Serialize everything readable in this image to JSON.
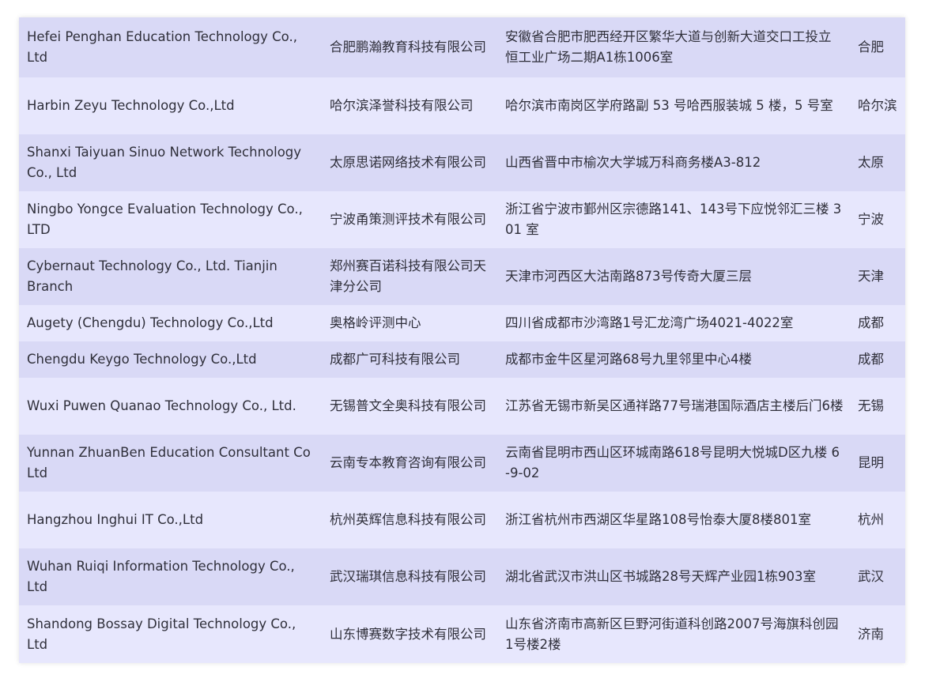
{
  "rows": [
    {
      "en": "Hefei Penghan Education Technology Co., Ltd",
      "cn": "合肥鹏瀚教育科技有限公司",
      "address": "安徽省合肥市肥西经开区繁华大道与创新大道交口工投立恒工业广场二期A1栋1006室",
      "city": "合肥"
    },
    {
      "en": "Harbin Zeyu Technology Co.,Ltd",
      "cn": "哈尔滨泽誉科技有限公司",
      "address": "哈尔滨市南岗区学府路副 53 号哈西服装城 5 楼，5 号室",
      "city": "哈尔滨"
    },
    {
      "en": "Shanxi Taiyuan Sinuo Network Technology Co., Ltd",
      "cn": "太原思诺网络技术有限公司",
      "address": "山西省晋中市榆次大学城万科商务楼A3-812",
      "city": "太原"
    },
    {
      "en": "Ningbo Yongce Evaluation Technology Co., LTD",
      "cn": "宁波甬策测评技术有限公司",
      "address": "浙江省宁波市鄞州区宗德路141、143号下应悦邻汇三楼 301 室",
      "city": "宁波"
    },
    {
      "en": "Cybernaut Technology Co., Ltd. Tianjin Branch",
      "cn": "郑州赛百诺科技有限公司天津分公司",
      "address": "天津市河西区大沽南路873号传奇大厦三层",
      "city": "天津"
    },
    {
      "en": "Augety (Chengdu) Technology Co.,Ltd",
      "cn": "奥格岭评测中心",
      "address": "四川省成都市沙湾路1号汇龙湾广场4021-4022室",
      "city": "成都"
    },
    {
      "en": "Chengdu Keygo Technology Co.,Ltd",
      "cn": "成都广可科技有限公司",
      "address": "成都市金牛区星河路68号九里邻里中心4楼",
      "city": "成都"
    },
    {
      "en": "Wuxi Puwen Quanao Technology Co., Ltd.",
      "cn": "无锡普文全奥科技有限公司",
      "address": "江苏省无锡市新吴区通祥路77号瑞港国际酒店主楼后门6楼",
      "city": "无锡"
    },
    {
      "en": "Yunnan ZhuanBen Education Consultant Co Ltd",
      "cn": "云南专本教育咨询有限公司",
      "address": "云南省昆明市西山区环城南路618号昆明大悦城D区九楼 6-9-02",
      "city": "昆明"
    },
    {
      "en": "Hangzhou Inghui IT Co.,Ltd",
      "cn": "杭州英辉信息科技有限公司",
      "address": "浙江省杭州市西湖区华星路108号怡泰大厦8楼801室",
      "city": "杭州"
    },
    {
      "en": "Wuhan Ruiqi Information Technology Co., Ltd",
      "cn": "武汉瑞琪信息科技有限公司",
      "address": "湖北省武汉市洪山区书城路28号天辉产业园1栋903室",
      "city": "武汉"
    },
    {
      "en": "Shandong Bossay Digital Technology Co., Ltd",
      "cn": "山东博赛数字技术有限公司",
      "address": "山东省济南市高新区巨野河街道科创路2007号海旗科创园1号楼2楼",
      "city": "济南"
    }
  ]
}
